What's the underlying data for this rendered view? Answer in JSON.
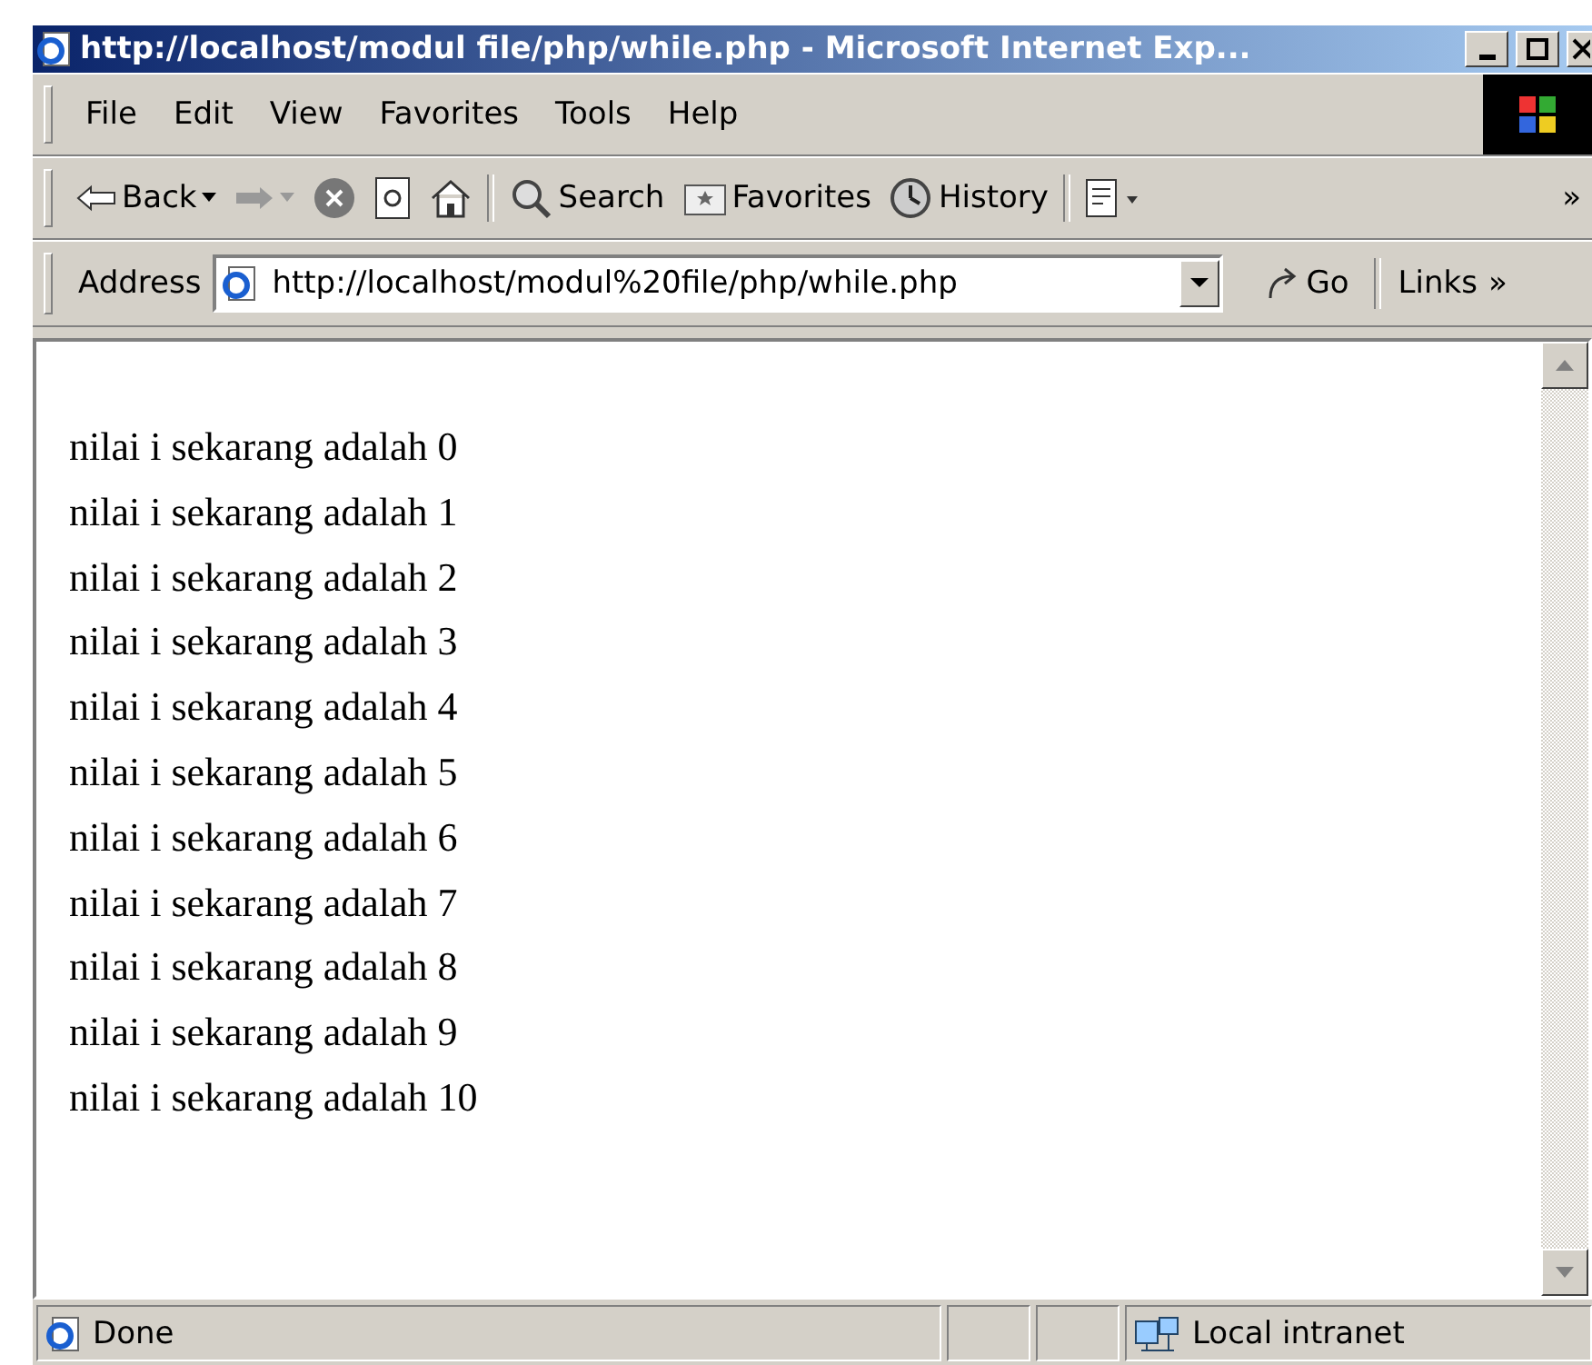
{
  "window": {
    "title": "http://localhost/modul file/php/while.php - Microsoft Internet Exp..."
  },
  "menu": [
    "File",
    "Edit",
    "View",
    "Favorites",
    "Tools",
    "Help"
  ],
  "toolbar": [
    {
      "kind": "back",
      "label": "Back",
      "disabled": false
    },
    {
      "kind": "forward",
      "disabled": true
    },
    {
      "kind": "stop",
      "disabled": false
    },
    {
      "kind": "refresh",
      "disabled": false
    },
    {
      "kind": "home",
      "disabled": false
    },
    {
      "kind": "search",
      "label": "Search",
      "disabled": false
    },
    {
      "kind": "favorites",
      "label": "Favorites",
      "disabled": false
    },
    {
      "kind": "history",
      "label": "History",
      "disabled": false
    },
    {
      "kind": "mail",
      "disabled": false
    }
  ],
  "toolbar_more": "»",
  "address_bar": {
    "label": "Address",
    "value": "http://localhost/modul%20file/php/while.php",
    "go": "Go",
    "links": "Links",
    "links_more": "»"
  },
  "content": {
    "lines": [
      "nilai i sekarang adalah 0",
      "nilai i sekarang adalah 1",
      "nilai i sekarang adalah 2",
      "nilai i sekarang adalah 3",
      "nilai i sekarang adalah 4",
      "nilai i sekarang adalah 5",
      "nilai i sekarang adalah 6",
      "nilai i sekarang adalah 7",
      "nilai i sekarang adalah 8",
      "nilai i sekarang adalah 9",
      "nilai i sekarang adalah 10"
    ]
  },
  "status_bar": {
    "status": "Done",
    "zone": "Local intranet"
  }
}
